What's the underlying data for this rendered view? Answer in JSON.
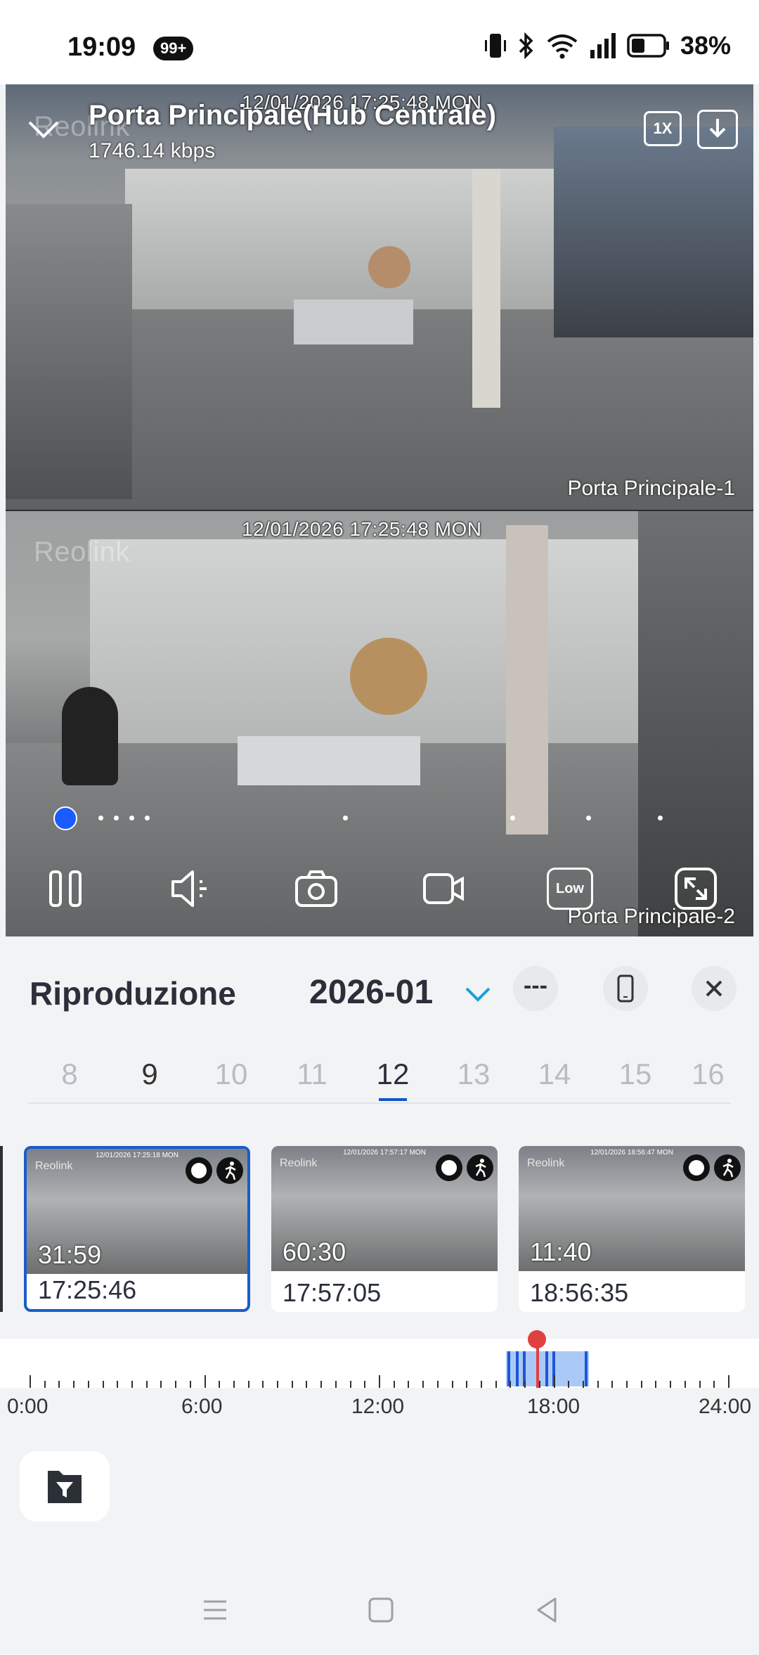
{
  "status_bar": {
    "time": "19:09",
    "notification_badge": "99+",
    "battery": "38%",
    "icons": [
      "vibrate-icon",
      "bluetooth-icon",
      "wifi-icon",
      "signal-icon",
      "battery-icon"
    ]
  },
  "player": {
    "title": "Porta Principale(Hub Centrale)",
    "bitrate": "1746.14 kbps",
    "speed_label": "1X",
    "quality_label": "Low",
    "camera1": {
      "timestamp": "12/01/2026 17:25:48 MON",
      "label": "Porta Principale-1",
      "watermark": "Reolink"
    },
    "camera2": {
      "timestamp": "12/01/2026 17:25:48 MON",
      "label": "Porta Principale-2",
      "watermark": "Reolink"
    },
    "controls": [
      "pause-icon",
      "speaker-icon",
      "snapshot-icon",
      "record-icon",
      "quality-low",
      "fullscreen-icon"
    ]
  },
  "playback": {
    "title": "Riproduzione",
    "month": "2026-01",
    "dash_label": "---",
    "days": [
      "8",
      "9",
      "10",
      "11",
      "12",
      "13",
      "14",
      "15",
      "16"
    ],
    "selected_day": "12",
    "recordings": [
      {
        "duration": "31:59",
        "start": "17:25:46",
        "osd": "12/01/2026 17:25:18 MON",
        "selected": true
      },
      {
        "duration": "60:30",
        "start": "17:57:05",
        "osd": "12/01/2026 17:57:17 MON",
        "selected": false
      },
      {
        "duration": "11:40",
        "start": "18:56:35",
        "osd": "12/01/2026 18:56:47 MON",
        "selected": false
      }
    ],
    "thumb_watermark": "Reolink",
    "timeline_labels": [
      "0:00",
      "6:00",
      "12:00",
      "18:00",
      "24:00"
    ]
  },
  "colors": {
    "accent": "#1a5cc9",
    "cursor": "#e04040",
    "recording_fill": "#aac9f7"
  }
}
